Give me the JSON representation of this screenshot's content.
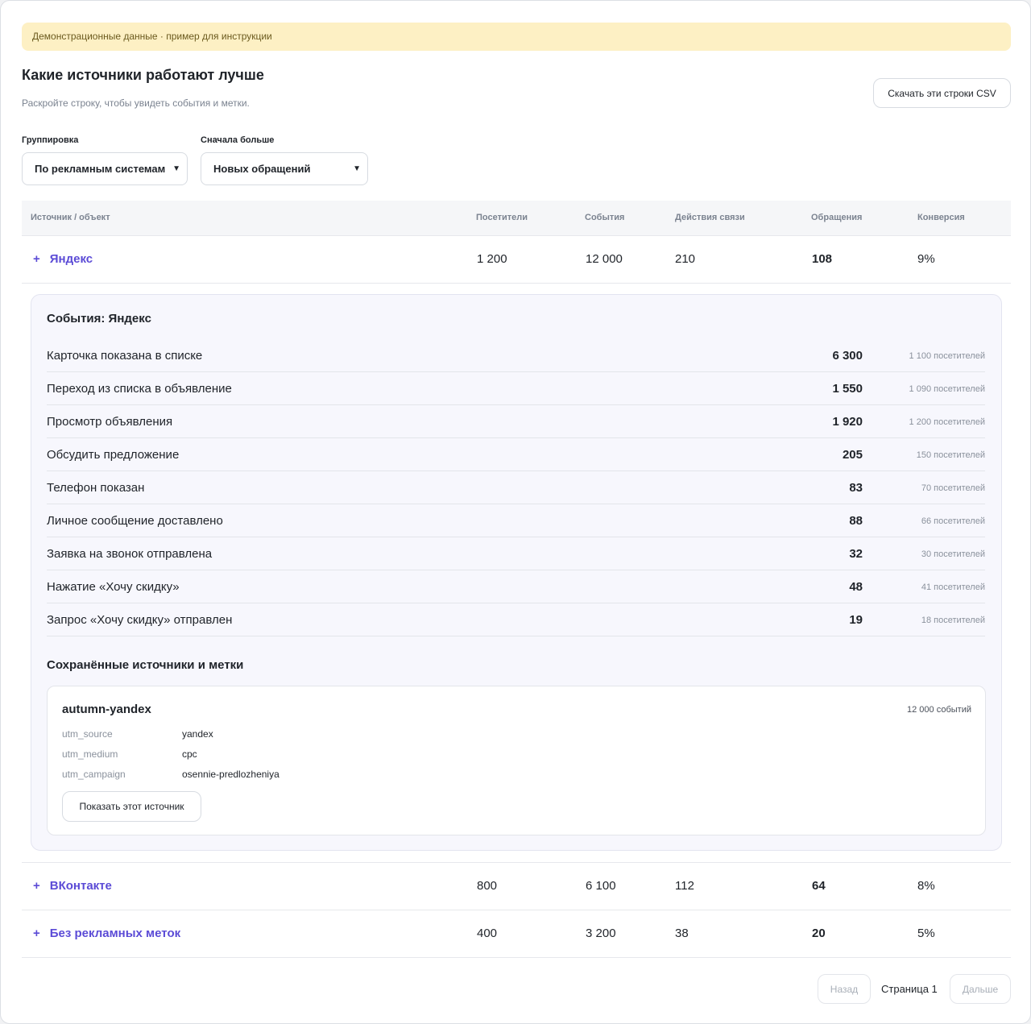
{
  "banner": "Демонстрационные данные · пример для инструкции",
  "header": {
    "title": "Какие источники работают лучше",
    "subtitle": "Раскройте строку, чтобы увидеть события и метки.",
    "csv_button": "Скачать эти строки CSV"
  },
  "filters": {
    "grouping_label": "Группировка",
    "grouping_value": "По рекламным системам",
    "sort_label": "Сначала больше",
    "sort_value": "Новых обращений"
  },
  "table": {
    "columns": [
      "Источник / объект",
      "Посетители",
      "События",
      "Действия связи",
      "Обращения",
      "Конверсия"
    ],
    "rows": [
      {
        "expand": "+",
        "source": "Яндекс",
        "visitors": "1 200",
        "events": "12 000",
        "contact_actions": "210",
        "requests": "108",
        "conversion": "9%"
      },
      {
        "expand": "+",
        "source": "ВКонтакте",
        "visitors": "800",
        "events": "6 100",
        "contact_actions": "112",
        "requests": "64",
        "conversion": "8%"
      },
      {
        "expand": "+",
        "source": "Без рекламных меток",
        "visitors": "400",
        "events": "3 200",
        "contact_actions": "38",
        "requests": "20",
        "conversion": "5%"
      }
    ]
  },
  "details": {
    "events_title": "События: Яндекс",
    "events": [
      {
        "name": "Карточка показана в списке",
        "count": "6 300",
        "visitors": "1 100 посетителей"
      },
      {
        "name": "Переход из списка в объявление",
        "count": "1 550",
        "visitors": "1 090 посетителей"
      },
      {
        "name": "Просмотр объявления",
        "count": "1 920",
        "visitors": "1 200 посетителей"
      },
      {
        "name": "Обсудить предложение",
        "count": "205",
        "visitors": "150 посетителей"
      },
      {
        "name": "Телефон показан",
        "count": "83",
        "visitors": "70 посетителей"
      },
      {
        "name": "Личное сообщение доставлено",
        "count": "88",
        "visitors": "66 посетителей"
      },
      {
        "name": "Заявка на звонок отправлена",
        "count": "32",
        "visitors": "30 посетителей"
      },
      {
        "name": "Нажатие «Хочу скидку»",
        "count": "48",
        "visitors": "41 посетителей"
      },
      {
        "name": "Запрос «Хочу скидку» отправлен",
        "count": "19",
        "visitors": "18 посетителей"
      }
    ],
    "saved_title": "Сохранённые источники и метки",
    "tag": {
      "name": "autumn-yandex",
      "events": "12 000 событий",
      "params": [
        {
          "key": "utm_source",
          "value": "yandex"
        },
        {
          "key": "utm_medium",
          "value": "cpc"
        },
        {
          "key": "utm_campaign",
          "value": "osennie-predlozheniya"
        }
      ],
      "show_button": "Показать этот источник"
    }
  },
  "pager": {
    "prev": "Назад",
    "page": "Страница 1",
    "next": "Дальше"
  },
  "icons": {
    "chevron": "chevron-down-icon",
    "expand": "plus-icon"
  },
  "colors": {
    "accent": "#5b4bd6",
    "banner_bg": "#fdf0c4"
  }
}
